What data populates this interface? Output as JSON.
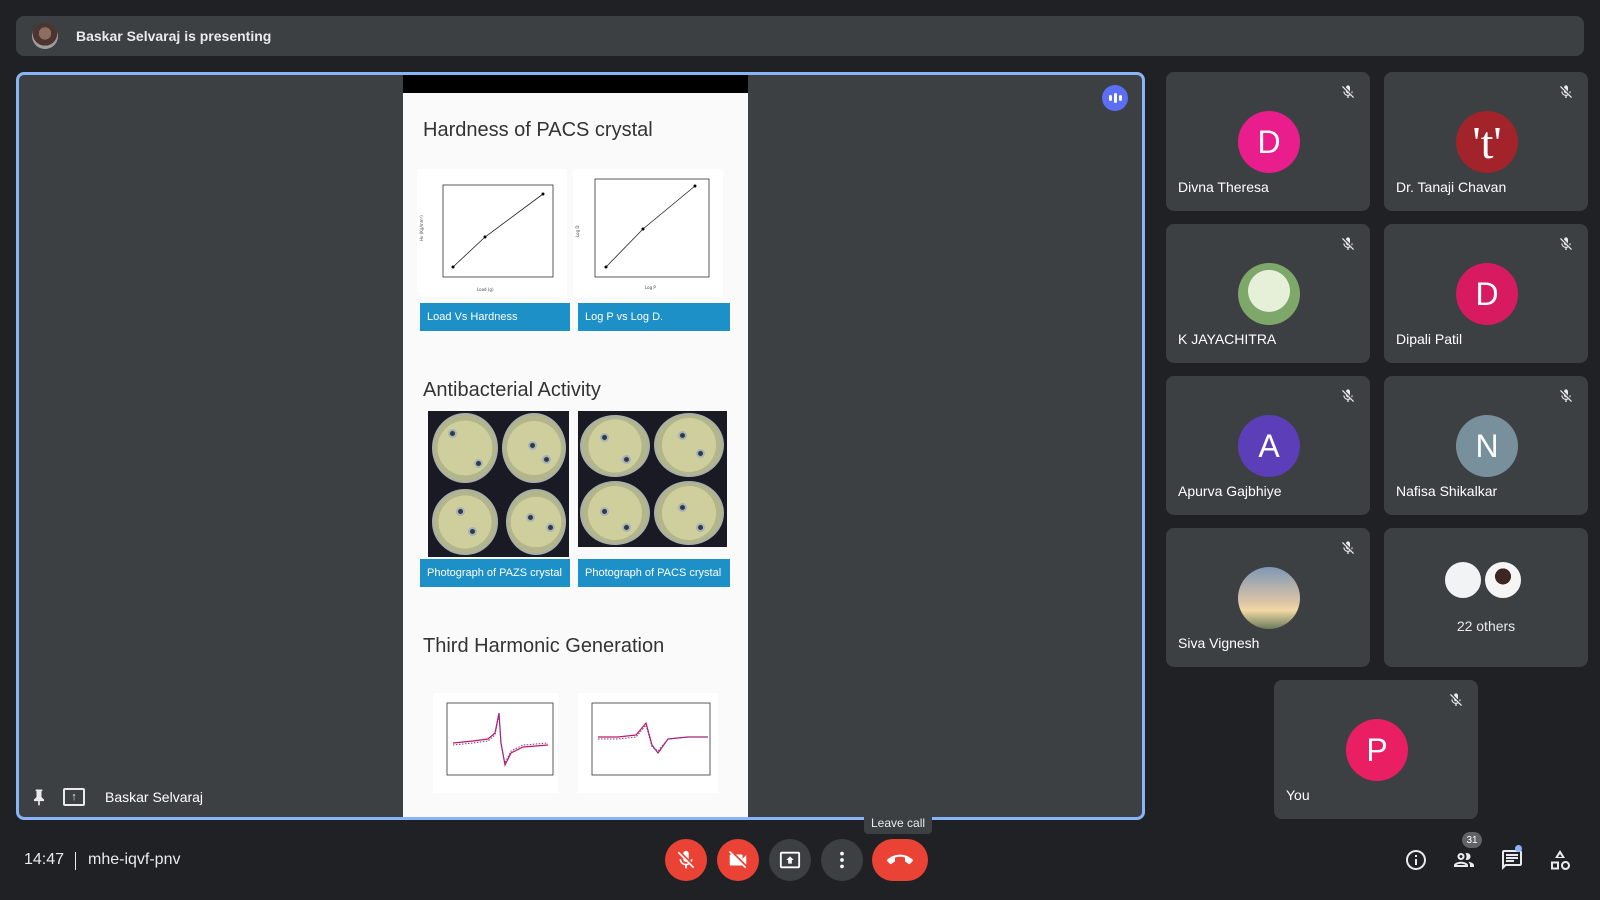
{
  "banner": {
    "text": "Baskar Selvaraj is presenting"
  },
  "presentation": {
    "presenter_name": "Baskar Selvaraj",
    "slide": {
      "section1_title": "Hardness of PACS crystal",
      "caption1": "Load Vs Hardness",
      "caption2": "Log P vs Log D.",
      "section2_title": "Antibacterial Activity",
      "caption3": "Photograph of PAZS crystal",
      "caption4": "Photograph of PACS crystal",
      "section3_title": "Third Harmonic Generation"
    }
  },
  "participants": [
    {
      "name": "Divna Theresa",
      "initial": "D",
      "color": "#e91e8c",
      "muted": true
    },
    {
      "name": "Dr. Tanaji Chavan",
      "initial": "'t'",
      "color": "#a3232b",
      "muted": true
    },
    {
      "name": "K JAYACHITRA",
      "initial": "",
      "color": "#9fbf8c",
      "muted": true
    },
    {
      "name": "Dipali Patil",
      "initial": "D",
      "color": "#d81b60",
      "muted": true
    },
    {
      "name": "Apurva Gajbhiye",
      "initial": "A",
      "color": "#5c3fb8",
      "muted": true
    },
    {
      "name": "Nafisa Shikalkar",
      "initial": "N",
      "color": "#78909c",
      "muted": true
    },
    {
      "name": "Siva Vignesh",
      "initial": "",
      "color": "#d9a77a",
      "muted": true
    }
  ],
  "others": {
    "label": "22 others"
  },
  "self": {
    "name": "You",
    "initial": "P",
    "color": "#e91e63"
  },
  "bottom_bar": {
    "time": "14:47",
    "meeting_code": "mhe-iqvf-pnv",
    "leave_tooltip": "Leave call",
    "people_count": "31"
  }
}
